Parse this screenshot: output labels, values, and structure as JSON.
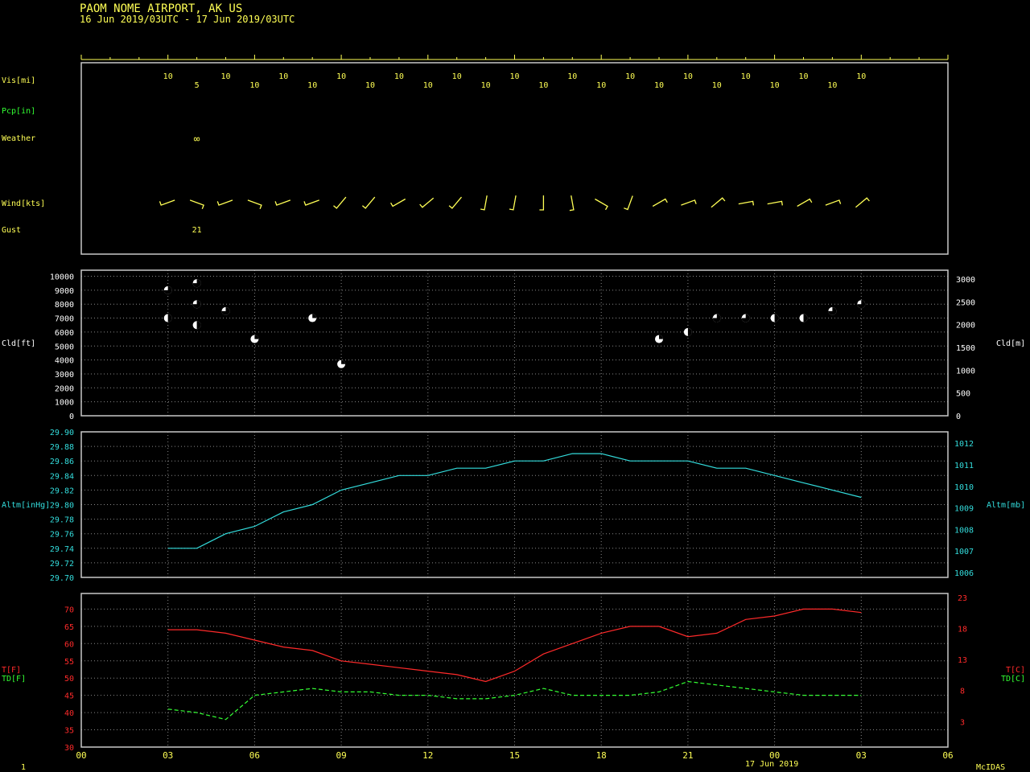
{
  "colors": {
    "background": "#000000",
    "frame": "#c8c8c8",
    "yellow": "#ffff55",
    "green": "#33ff33",
    "cyan": "#33dddd",
    "red": "#ff2a2a",
    "white": "#ffffff",
    "grid": "#888888"
  },
  "header": {
    "station": "PAOM  NOME AIRPORT, AK US",
    "period": "16 Jun 2019/03UTC - 17 Jun 2019/03UTC"
  },
  "footer": {
    "page_number": "1",
    "software": "McIDAS",
    "date_label": "17 Jun 2019"
  },
  "chart_data": [
    {
      "type": "table",
      "panel": "surface",
      "row_labels": {
        "vis": "Vis[mi]",
        "pcp": "Pcp[in]",
        "weather": "Weather",
        "wind": "Wind[kts]",
        "gust": "Gust"
      },
      "hours": [
        3,
        4,
        5,
        6,
        7,
        8,
        9,
        10,
        11,
        12,
        13,
        14,
        15,
        16,
        17,
        18,
        19,
        20,
        21,
        22,
        23,
        24,
        25,
        26,
        27
      ],
      "visibility": [
        "10",
        "5",
        "10",
        "10",
        "10",
        "10",
        "10",
        "10",
        "10",
        "10",
        "10",
        "10",
        "10",
        "10",
        "10",
        "10",
        "10",
        "10",
        "10",
        "10",
        "10",
        "10",
        "10",
        "10",
        "10"
      ],
      "weather": [
        {
          "hour": 4,
          "symbol": "∞"
        }
      ],
      "gust": [
        {
          "hour": 4,
          "value": "21"
        }
      ],
      "wind_direction_deg": [
        250,
        110,
        250,
        110,
        250,
        250,
        220,
        220,
        240,
        230,
        220,
        190,
        190,
        180,
        170,
        120,
        200,
        60,
        70,
        50,
        80,
        80,
        60,
        70,
        50
      ]
    },
    {
      "type": "scatter",
      "panel": "cloud",
      "ylabel": "Cld[ft]",
      "ylabel_right": "Cld[m]",
      "y_ticks": [
        "0",
        "1000",
        "2000",
        "3000",
        "4000",
        "5000",
        "6000",
        "7000",
        "8000",
        "9000",
        "10000"
      ],
      "y_ticks_right": [
        "0",
        "500",
        "1000",
        "1500",
        "2000",
        "2500",
        "3000"
      ],
      "ylim": [
        0,
        10000
      ],
      "points": [
        {
          "hour": 3,
          "ft": 9000,
          "cover": "broken"
        },
        {
          "hour": 3,
          "ft": 7000,
          "cover": "scattered"
        },
        {
          "hour": 4,
          "ft": 9500,
          "cover": "broken"
        },
        {
          "hour": 4,
          "ft": 8000,
          "cover": "broken"
        },
        {
          "hour": 4,
          "ft": 6500,
          "cover": "scattered"
        },
        {
          "hour": 5,
          "ft": 7500,
          "cover": "broken"
        },
        {
          "hour": 6,
          "ft": 5500,
          "cover": "few"
        },
        {
          "hour": 8,
          "ft": 7000,
          "cover": "few"
        },
        {
          "hour": 9,
          "ft": 3700,
          "cover": "few"
        },
        {
          "hour": 20,
          "ft": 5500,
          "cover": "few"
        },
        {
          "hour": 21,
          "ft": 6000,
          "cover": "scattered"
        },
        {
          "hour": 22,
          "ft": 7000,
          "cover": "broken"
        },
        {
          "hour": 23,
          "ft": 7000,
          "cover": "broken"
        },
        {
          "hour": 24,
          "ft": 7000,
          "cover": "scattered"
        },
        {
          "hour": 25,
          "ft": 7000,
          "cover": "scattered"
        },
        {
          "hour": 26,
          "ft": 7500,
          "cover": "broken"
        },
        {
          "hour": 27,
          "ft": 8000,
          "cover": "broken"
        }
      ]
    },
    {
      "type": "line",
      "panel": "altimeter",
      "ylabel": "Altm[inHg]",
      "ylabel_right": "Altm[mb]",
      "y_ticks": [
        "29.70",
        "29.72",
        "29.74",
        "29.76",
        "29.78",
        "29.80",
        "29.82",
        "29.84",
        "29.86",
        "29.88",
        "29.90"
      ],
      "y_ticks_right": [
        "1006",
        "1007",
        "1008",
        "1009",
        "1010",
        "1011",
        "1012"
      ],
      "ylim": [
        29.7,
        29.9
      ],
      "x": [
        3,
        4,
        5,
        6,
        7,
        8,
        9,
        10,
        11,
        12,
        13,
        14,
        15,
        16,
        17,
        18,
        19,
        20,
        21,
        22,
        23,
        24,
        25,
        26,
        27
      ],
      "series": [
        {
          "values": [
            29.74,
            29.74,
            29.76,
            29.77,
            29.79,
            29.8,
            29.82,
            29.83,
            29.84,
            29.84,
            29.85,
            29.85,
            29.86,
            29.86,
            29.87,
            29.87,
            29.86,
            29.86,
            29.86,
            29.85,
            29.85,
            29.84,
            29.83,
            29.82,
            29.81
          ]
        }
      ]
    },
    {
      "type": "line",
      "panel": "temperature",
      "ylabel": "T[F]",
      "ylabel2": "TD[F]",
      "ylabel_right": "T[C]",
      "ylabel2_right": "TD[C]",
      "y_ticks": [
        "30",
        "35",
        "40",
        "45",
        "50",
        "55",
        "60",
        "65",
        "70"
      ],
      "y_ticks_right": [
        "3",
        "8",
        "13",
        "18",
        "23"
      ],
      "ylim": [
        30,
        73
      ],
      "x": [
        3,
        4,
        5,
        6,
        7,
        8,
        9,
        10,
        11,
        12,
        13,
        14,
        15,
        16,
        17,
        18,
        19,
        20,
        21,
        22,
        23,
        24,
        25,
        26,
        27
      ],
      "series": [
        {
          "values": [
            64,
            64,
            63,
            61,
            59,
            58,
            55,
            54,
            53,
            52,
            51,
            49,
            52,
            57,
            60,
            63,
            65,
            65,
            62,
            63,
            67,
            68,
            70,
            70,
            69
          ]
        },
        {
          "values": [
            41,
            40,
            38,
            45,
            46,
            47,
            46,
            46,
            45,
            45,
            44,
            44,
            45,
            47,
            45,
            45,
            45,
            46,
            49,
            48,
            47,
            46,
            45,
            45,
            45
          ]
        }
      ],
      "x_ticks": [
        "00",
        "03",
        "06",
        "09",
        "12",
        "15",
        "18",
        "21",
        "00",
        "03",
        "06"
      ]
    }
  ]
}
